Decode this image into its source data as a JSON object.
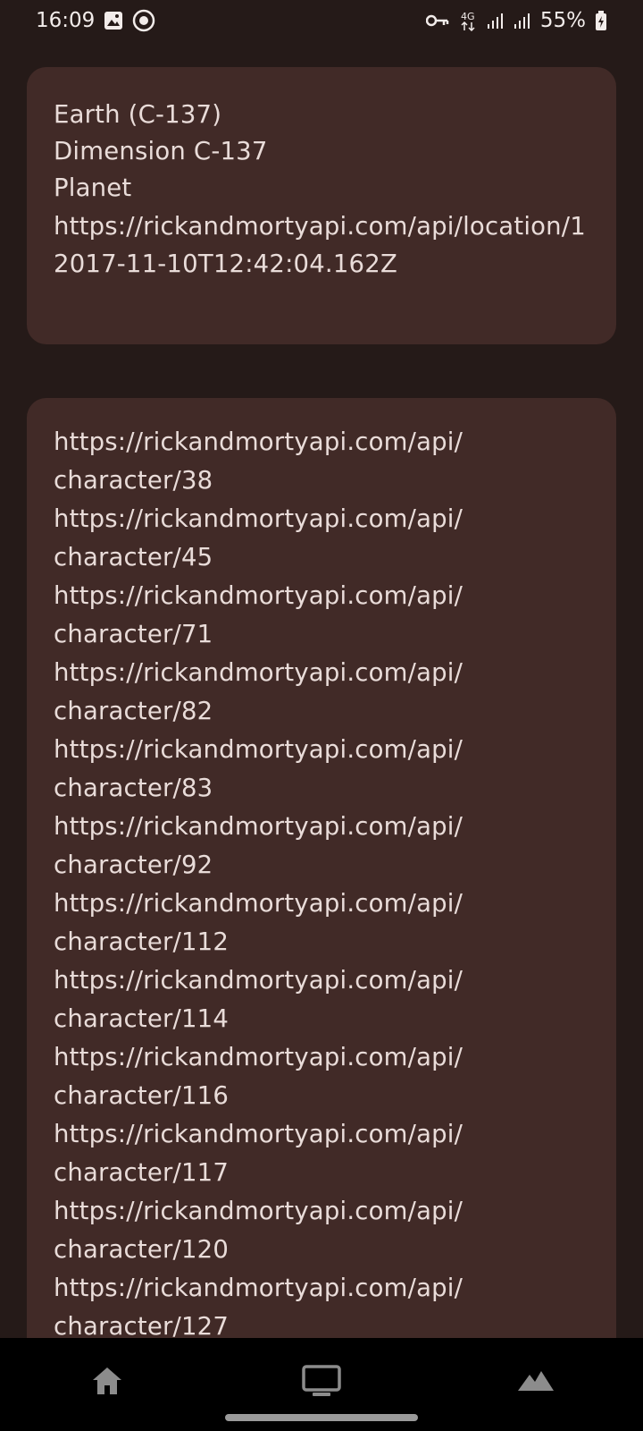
{
  "status_bar": {
    "time": "16:09",
    "battery": "55%",
    "icons": [
      "image-icon",
      "app-notification-icon",
      "key-icon",
      "4g-icon",
      "signal-icon",
      "signal-icon",
      "battery-icon"
    ]
  },
  "location": {
    "name": "Earth (C-137)",
    "dimension": "Dimension C-137",
    "type": "Planet",
    "url": "https://rickandmortyapi.com/api/location/1",
    "created": "2017-11-10T12:42:04.162Z"
  },
  "residents": [
    "https://rickandmortyapi.com/api/character/38",
    "https://rickandmortyapi.com/api/character/45",
    "https://rickandmortyapi.com/api/character/71",
    "https://rickandmortyapi.com/api/character/82",
    "https://rickandmortyapi.com/api/character/83",
    "https://rickandmortyapi.com/api/character/92",
    "https://rickandmortyapi.com/api/character/112",
    "https://rickandmortyapi.com/api/character/114",
    "https://rickandmortyapi.com/api/character/116",
    "https://rickandmortyapi.com/api/character/117",
    "https://rickandmortyapi.com/api/character/120",
    "https://rickandmortyapi.com/api/character/127"
  ],
  "bottom_nav": {
    "items": [
      "home-icon",
      "monitor-icon",
      "landscape-icon"
    ]
  }
}
